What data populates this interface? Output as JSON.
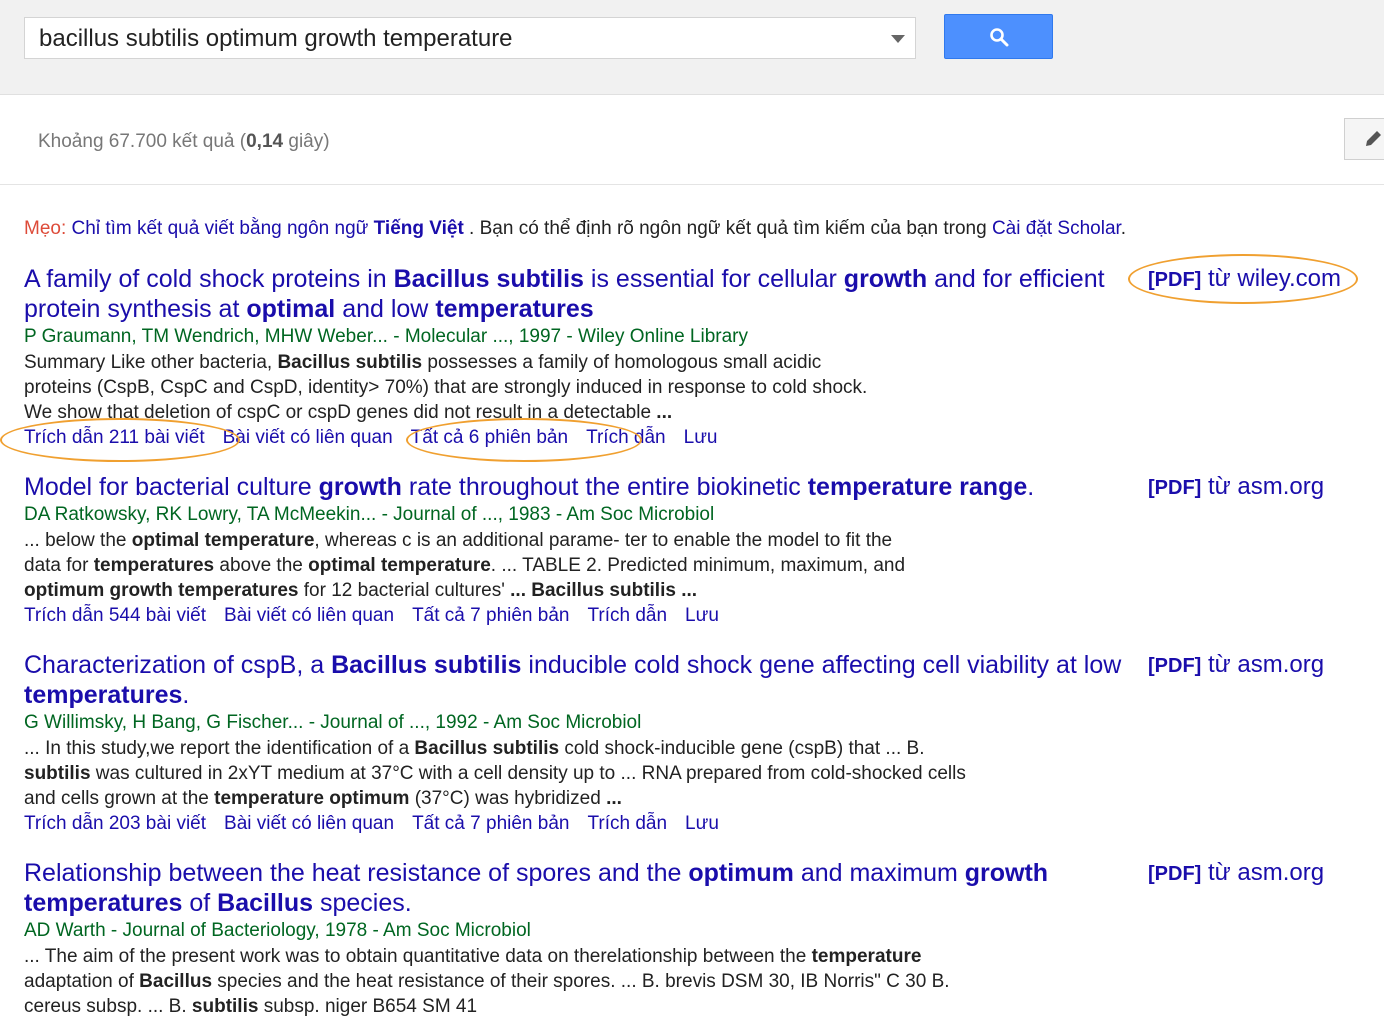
{
  "search": {
    "query": "bacillus subtilis optimum growth temperature"
  },
  "stats": {
    "prefix": "Khoảng 67.700 kết quả (",
    "time": "0,14",
    "suffix": " giây)"
  },
  "tip": {
    "label": "Mẹo:",
    "link1": "Chỉ tìm kết quả viết bằng ngôn ngữ ",
    "link1_bold": "Tiếng Việt",
    "text": " . Bạn có thể định rõ ngôn ngữ kết quả tìm kiếm của bạn trong ",
    "link2": "Cài đặt Scholar",
    "end": "."
  },
  "results": [
    {
      "title_parts": [
        "A family of cold shock proteins in ",
        "Bacillus subtilis",
        " is essential for cellular ",
        "growth",
        " and for efficient protein synthesis at ",
        "optimal",
        " and low ",
        "temperatures"
      ],
      "meta": "P Graumann, TM Wendrich, MHW Weber... - Molecular ..., 1997 - Wiley Online Library",
      "snippet_parts": [
        "Summary Like other bacteria, ",
        "Bacillus subtilis",
        " possesses a family of homologous small acidic proteins (CspB, CspC and CspD, identity> 70%) that are strongly induced in response to cold shock. We show that deletion of cspC or cspD genes did not result in a detectable ",
        "...",
        ""
      ],
      "links": [
        "Trích dẫn 211 bài viết",
        "Bài viết có liên quan",
        "Tất cả 6 phiên bản",
        "Trích dẫn",
        "Lưu"
      ],
      "pdf_tag": "[PDF]",
      "pdf_source": " từ wiley.com"
    },
    {
      "title_parts": [
        "Model for bacterial culture ",
        "growth",
        " rate throughout the entire biokinetic ",
        "temperature range",
        ".",
        "",
        "",
        ""
      ],
      "meta": "DA Ratkowsky, RK Lowry, TA McMeekin... - Journal of ..., 1983 - Am Soc Microbiol",
      "snippet_parts": [
        "... below the ",
        "optimal temperature",
        ", whereas c is an additional parame- ter to enable the model to fit the data for ",
        "temperatures",
        " above the ",
        "optimal temperature",
        ". ... TABLE 2. Predicted minimum, maximum, and ",
        "optimum growth temperatures",
        " for 12 bacterial cultures' ",
        "... Bacillus subtilis ...",
        ""
      ],
      "links": [
        "Trích dẫn 544 bài viết",
        "Bài viết có liên quan",
        "Tất cả 7 phiên bản",
        "Trích dẫn",
        "Lưu"
      ],
      "pdf_tag": "[PDF]",
      "pdf_source": " từ asm.org"
    },
    {
      "title_parts": [
        "Characterization of cspB, a ",
        "Bacillus subtilis",
        " inducible cold shock gene affecting cell viability at low ",
        "temperatures",
        ".",
        "",
        "",
        ""
      ],
      "meta": "G Willimsky, H Bang, G Fischer... - Journal of ..., 1992 - Am Soc Microbiol",
      "snippet_parts": [
        "... In this study,we report the identification of a ",
        "Bacillus subtilis",
        " cold shock-inducible gene (cspB) that ... B. ",
        "subtilis",
        " was cultured in 2xYT medium at 37°C with a cell density up to ... RNA prepared from cold-shocked cells and cells grown at the ",
        "temperature optimum",
        " (37°C) was hybridized ",
        "...",
        ""
      ],
      "links": [
        "Trích dẫn 203 bài viết",
        "Bài viết có liên quan",
        "Tất cả 7 phiên bản",
        "Trích dẫn",
        "Lưu"
      ],
      "pdf_tag": "[PDF]",
      "pdf_source": " từ asm.org"
    },
    {
      "title_parts": [
        "Relationship between the heat resistance of spores and the ",
        "optimum",
        " and maximum ",
        "growth",
        " ",
        "temperatures",
        " of ",
        "Bacillus",
        " species."
      ],
      "meta": "AD Warth - Journal of Bacteriology, 1978 - Am Soc Microbiol",
      "snippet_parts": [
        "... The aim of the present work was to obtain quantitative data on therelationship between the ",
        "temperature",
        " adaptation of ",
        "Bacillus",
        " species and the heat resistance of their spores. ... B. brevis DSM 30, IB Norris\" C 30 B. cereus subsp. ... B. ",
        "subtilis",
        " subsp. niger B654 SM 41"
      ],
      "links": [],
      "pdf_tag": "[PDF]",
      "pdf_source": " từ asm.org"
    }
  ],
  "colors": {
    "link": "#1a0dab",
    "meta": "#006621",
    "highlight": "#f0a030",
    "search_button": "#4d90fe"
  }
}
